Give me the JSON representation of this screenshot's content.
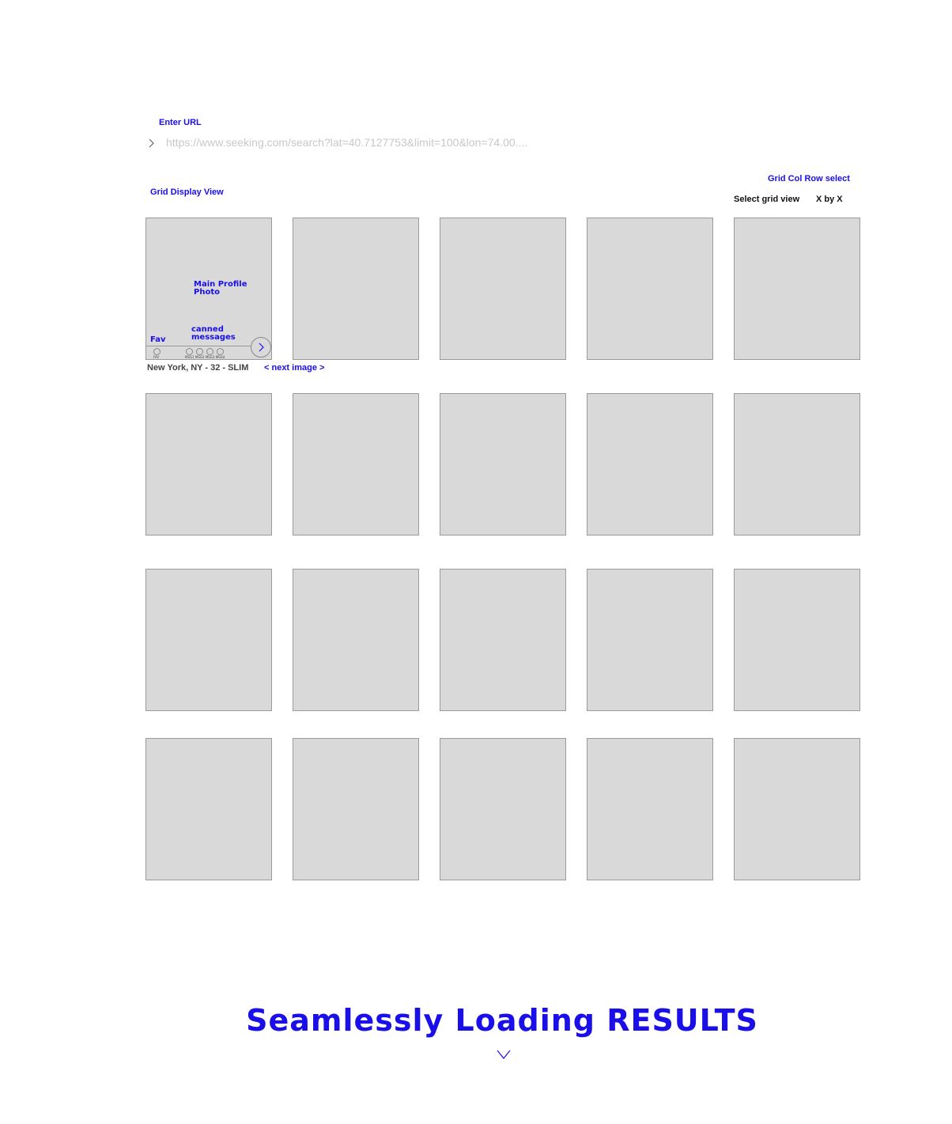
{
  "url_section": {
    "label": "Enter URL",
    "placeholder": "https://www.seeking.com/search?lat=40.7127753&limit=100&lon=74.00...."
  },
  "grid_col_row": {
    "annotation": "Grid Col Row select",
    "select_label": "Select grid view",
    "select_value": "X by X"
  },
  "grid_display": {
    "label": "Grid Display View"
  },
  "first_tile": {
    "main_photo_label_line1": "Main Profile",
    "main_photo_label_line2": "Photo",
    "fav_label": "Fav",
    "canned_label_line1": "canned",
    "canned_label_line2": "messages",
    "fav_small": "FAV",
    "msg_small": "MSG1 MSG2 MSG3 MSG4",
    "caption": "New York, NY - 32 - SLIM",
    "next_link": "< next image >"
  },
  "grid": {
    "columns": 5,
    "rows": 4
  },
  "footer": {
    "title": "Seamlessly Loading RESULTS"
  },
  "colors": {
    "accent": "#1a0fe8",
    "tile_fill": "#d9d9d9",
    "tile_border": "#9a9a9a"
  }
}
